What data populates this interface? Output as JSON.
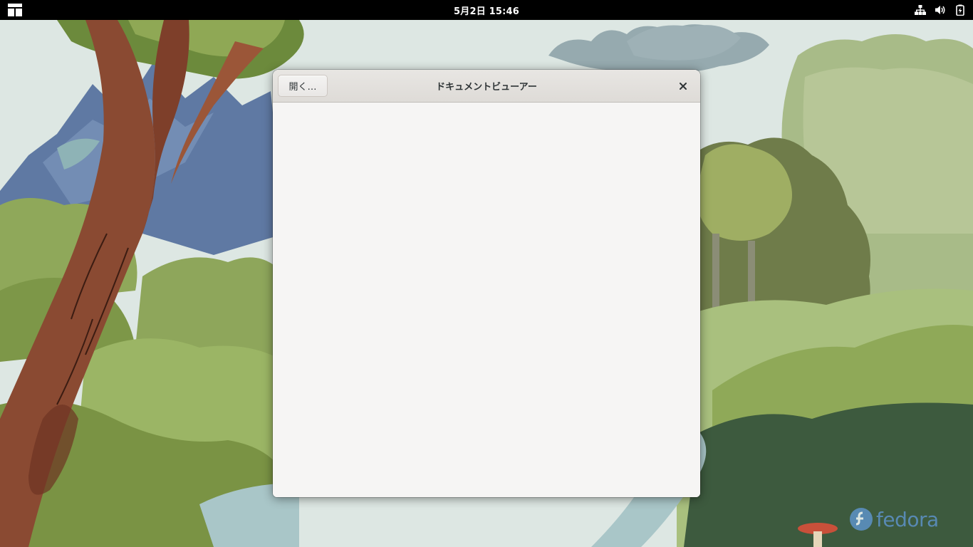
{
  "topbar": {
    "activities_icon": "activities-grid-icon",
    "clock": "5月2日  15:46",
    "status_icons": [
      "network-wired-icon",
      "volume-icon",
      "battery-icon"
    ]
  },
  "window": {
    "title": "ドキュメントビューアー",
    "open_button_label": "開く…",
    "close_icon": "close-icon"
  },
  "desktop": {
    "logo_text": "fedora"
  },
  "colors": {
    "topbar": "#000000",
    "headerbar": "#e1dedb",
    "window_bg": "#f6f5f4",
    "text": "#2e3436",
    "fedora_blue": "#5b8fc0"
  }
}
